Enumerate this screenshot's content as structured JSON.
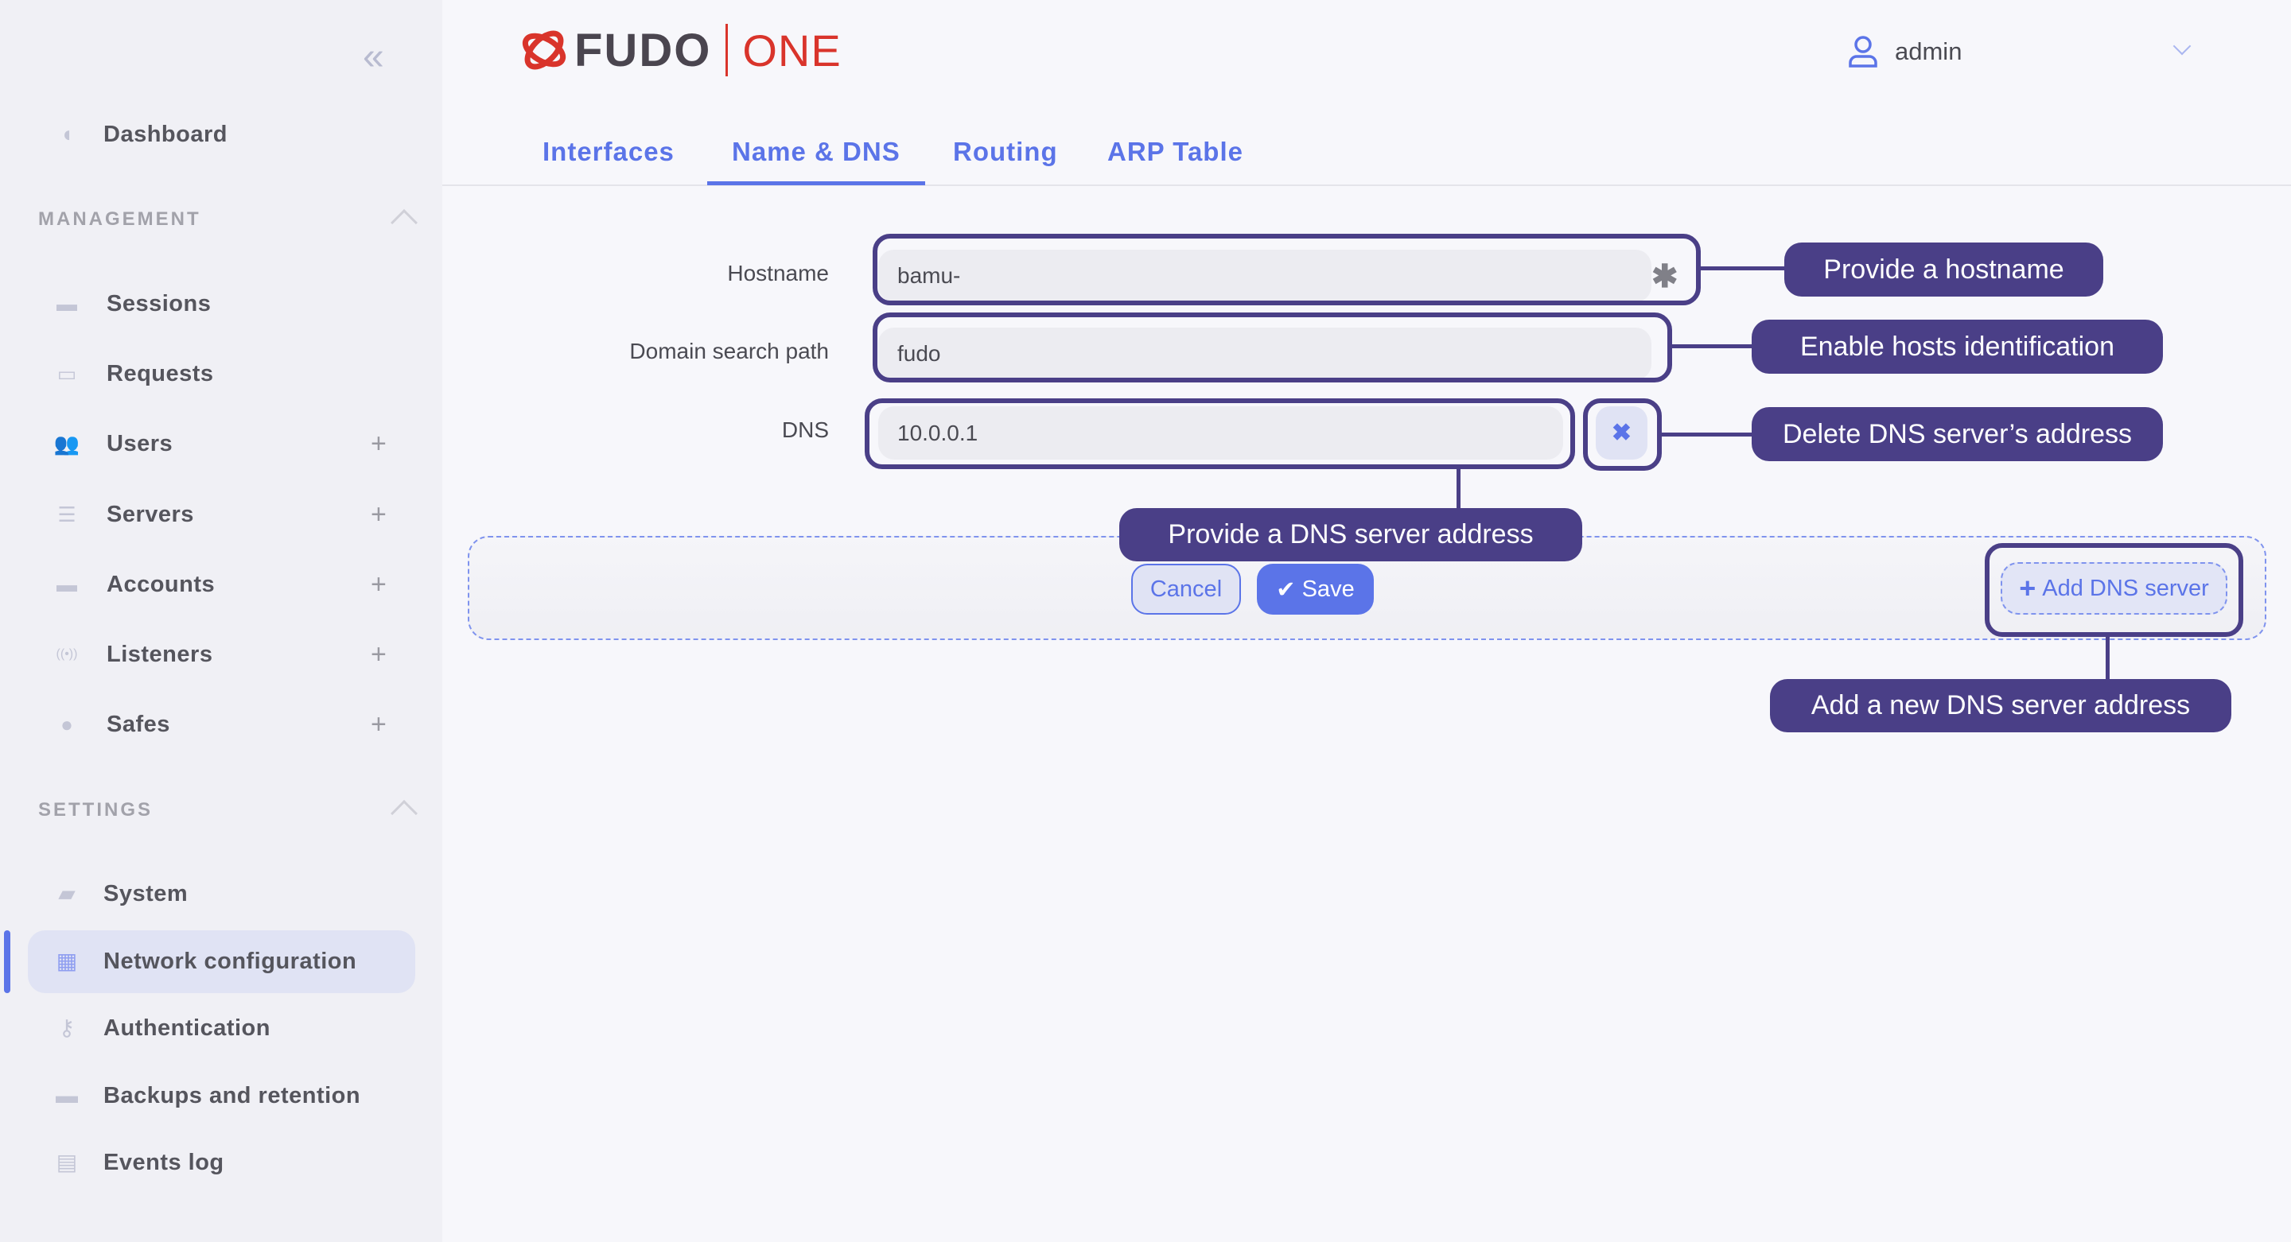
{
  "sidebar": {
    "dashboard": "Dashboard",
    "management_title": "MANAGEMENT",
    "management_items": [
      {
        "label": "Sessions",
        "icon": "camera-icon",
        "plus": false
      },
      {
        "label": "Requests",
        "icon": "briefcase-clock-icon",
        "plus": false
      },
      {
        "label": "Users",
        "icon": "users-icon",
        "plus": true
      },
      {
        "label": "Servers",
        "icon": "server-icon",
        "plus": true
      },
      {
        "label": "Accounts",
        "icon": "account-folder-icon",
        "plus": true
      },
      {
        "label": "Listeners",
        "icon": "broadcast-icon",
        "plus": true
      },
      {
        "label": "Safes",
        "icon": "user-shield-icon",
        "plus": true
      }
    ],
    "settings_title": "SETTINGS",
    "settings_items": [
      {
        "label": "System",
        "icon": "folder-icon"
      },
      {
        "label": "Network configuration",
        "icon": "network-icon",
        "active": true
      },
      {
        "label": "Authentication",
        "icon": "key-icon"
      },
      {
        "label": "Backups and retention",
        "icon": "box-icon"
      },
      {
        "label": "Events log",
        "icon": "calendar-alert-icon"
      }
    ],
    "plus_symbol": "+"
  },
  "header": {
    "logo_text": "FUDO",
    "logo_suffix": "ONE",
    "user": "admin"
  },
  "tabs": [
    {
      "label": "Interfaces"
    },
    {
      "label": "Name & DNS",
      "active": true
    },
    {
      "label": "Routing"
    },
    {
      "label": "ARP Table"
    }
  ],
  "form": {
    "hostname_label": "Hostname",
    "hostname_value": "bamu-",
    "domain_label": "Domain search path",
    "domain_value": "fudo",
    "dns_label": "DNS",
    "dns_value": "10.0.0.1",
    "cancel": "Cancel",
    "save": "Save",
    "add_dns": "Add DNS server"
  },
  "callouts": {
    "hostname": "Provide a hostname",
    "domain": "Enable hosts identification",
    "delete_dns": "Delete DNS server’s address",
    "dns": "Provide a DNS server address",
    "add_dns": "Add a new DNS server address"
  },
  "colors": {
    "accent": "#5b74e8",
    "callout": "#4a3f87",
    "logo_red": "#d9342b"
  }
}
